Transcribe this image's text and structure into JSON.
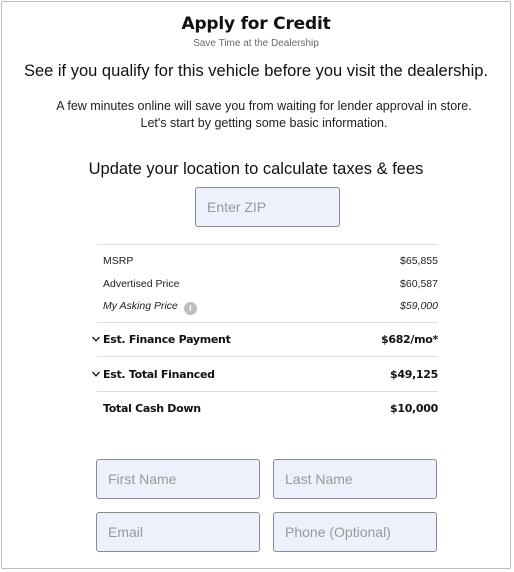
{
  "header": {
    "title": "Apply for Credit",
    "subtitle": "Save Time at the Dealership"
  },
  "intro": {
    "headline": "See if you qualify for this vehicle before you visit the dealership.",
    "body": "A few minutes online will save you from waiting for lender approval in store. Let's start by getting some basic information."
  },
  "location": {
    "heading": "Update your location to calculate taxes & fees",
    "zip_placeholder": "Enter ZIP",
    "zip_value": ""
  },
  "pricing": {
    "msrp_label": "MSRP",
    "msrp_value": "$65,855",
    "advertised_label": "Advertised Price",
    "advertised_value": "$60,587",
    "asking_label": "My Asking Price",
    "asking_value": "$59,000",
    "info_icon": "info-icon"
  },
  "summary": {
    "finance_label": "Est. Finance Payment",
    "finance_value": "$682/mo*",
    "financed_label": "Est. Total Financed",
    "financed_value": "$49,125",
    "cash_label": "Total Cash Down",
    "cash_value": "$10,000",
    "expand_icon": "chevron-down-icon"
  },
  "form": {
    "first_name_placeholder": "First Name",
    "last_name_placeholder": "Last Name",
    "email_placeholder": "Email",
    "phone_placeholder": "Phone (Optional)"
  },
  "colors": {
    "input_bg": "#eef0fb",
    "input_border": "#8a8a8a",
    "divider": "#dcdcdc",
    "info_icon": "#bdbdbd"
  }
}
